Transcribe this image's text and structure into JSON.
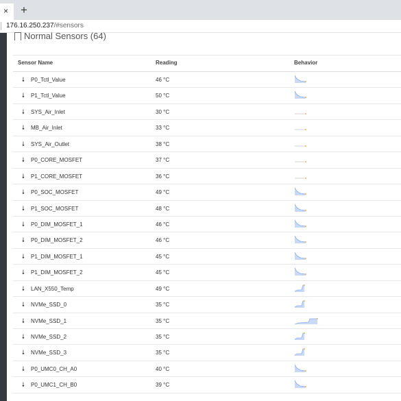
{
  "browser": {
    "tab_close_glyph": "×",
    "new_tab_glyph": "+",
    "url_host": "176.16.250.237",
    "url_path": "/#sensors"
  },
  "section": {
    "title": "Normal Sensors (64)"
  },
  "table": {
    "headers": {
      "name": "Sensor Name",
      "reading": "Reading",
      "behavior": "Behavior"
    },
    "rows": [
      {
        "name": "P0_Tctl_Value",
        "reading": "46 °C",
        "trend": "drop"
      },
      {
        "name": "P1_Tctl_Value",
        "reading": "50 °C",
        "trend": "drop"
      },
      {
        "name": "SYS_Air_Inlet",
        "reading": "30 °C",
        "trend": "flat"
      },
      {
        "name": "MB_Air_Inlet",
        "reading": "33 °C",
        "trend": "flat"
      },
      {
        "name": "SYS_Air_Outlet",
        "reading": "38 °C",
        "trend": "flat"
      },
      {
        "name": "P0_CORE_MOSFET",
        "reading": "37 °C",
        "trend": "flat"
      },
      {
        "name": "P1_CORE_MOSFET",
        "reading": "36 °C",
        "trend": "flat"
      },
      {
        "name": "P0_SOC_MOSFET",
        "reading": "49 °C",
        "trend": "drop"
      },
      {
        "name": "P1_SOC_MOSFET",
        "reading": "48 °C",
        "trend": "drop"
      },
      {
        "name": "P0_DIM_MOSFET_1",
        "reading": "46 °C",
        "trend": "drop"
      },
      {
        "name": "P0_DIM_MOSFET_2",
        "reading": "46 °C",
        "trend": "drop"
      },
      {
        "name": "P1_DIM_MOSFET_1",
        "reading": "45 °C",
        "trend": "drop"
      },
      {
        "name": "P1_DIM_MOSFET_2",
        "reading": "45 °C",
        "trend": "drop"
      },
      {
        "name": "LAN_X550_Temp",
        "reading": "49 °C",
        "trend": "rise"
      },
      {
        "name": "NVMe_SSD_0",
        "reading": "35 °C",
        "trend": "rise"
      },
      {
        "name": "NVMe_SSD_1",
        "reading": "35 °C",
        "trend": "rise-wide"
      },
      {
        "name": "NVMe_SSD_2",
        "reading": "35 °C",
        "trend": "rise"
      },
      {
        "name": "NVMe_SSD_3",
        "reading": "35 °C",
        "trend": "rise"
      },
      {
        "name": "P0_UMC0_CH_A0",
        "reading": "40 °C",
        "trend": "drop"
      },
      {
        "name": "P0_UMC1_CH_B0",
        "reading": "39 °C",
        "trend": "drop"
      }
    ]
  },
  "icons": {
    "row": "down-arrow-icon",
    "section": "bookmark-icon"
  },
  "colors": {
    "spark_fill": "#c9d9f6",
    "spark_line": "#8aaef0",
    "spark_dot": "#f0a030",
    "sidebar": "#343a40"
  }
}
